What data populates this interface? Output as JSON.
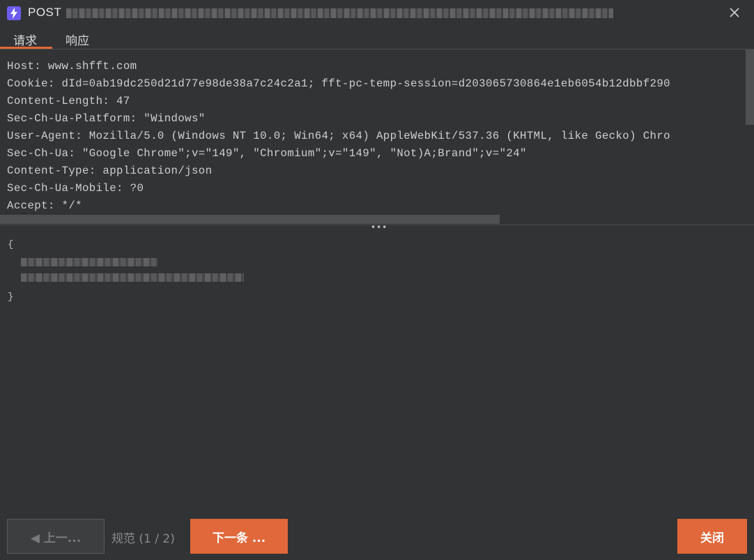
{
  "window": {
    "method": "POST",
    "icon": "lightning-icon",
    "close_icon": "close-icon"
  },
  "tabs": [
    {
      "label": "请求",
      "active": true
    },
    {
      "label": "响应",
      "active": false
    }
  ],
  "request_headers": [
    "Host: www.shfft.com",
    "Cookie: dId=0ab19dc250d21d77e98de38a7c24c2a1; fft-pc-temp-session=d203065730864e1eb6054b12dbbf290",
    "Content-Length: 47",
    "Sec-Ch-Ua-Platform: \"Windows\"",
    "User-Agent: Mozilla/5.0 (Windows NT 10.0; Win64; x64) AppleWebKit/537.36 (KHTML, like Gecko) Chro",
    "Sec-Ch-Ua: \"Google Chrome\";v=\"149\", \"Chromium\";v=\"149\", \"Not)A;Brand\";v=\"24\"",
    "Content-Type: application/json",
    "Sec-Ch-Ua-Mobile: ?0",
    "Accept: */*"
  ],
  "request_body": {
    "open": "{",
    "close": "}"
  },
  "footer": {
    "prev_label": "◀ 上一...",
    "spec_label": "规范 (1 / 2)",
    "next_label": "下一条 ...",
    "close_label": "关闭"
  },
  "colors": {
    "background": "#323335",
    "accent": "#e0683a",
    "app_icon": "#6d5cf0"
  }
}
